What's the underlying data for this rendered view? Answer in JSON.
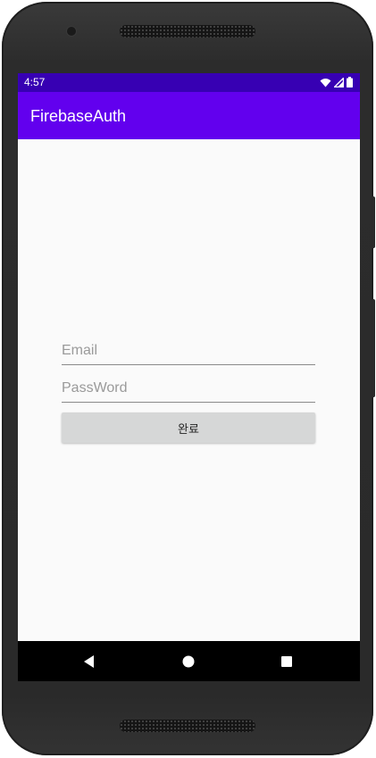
{
  "status_bar": {
    "time": "4:57",
    "color": "#3700b3"
  },
  "app_bar": {
    "title": "FirebaseAuth",
    "color": "#6200ee"
  },
  "form": {
    "email_placeholder": "Email",
    "email_value": "",
    "password_placeholder": "PassWord",
    "password_value": "",
    "submit_label": "완료"
  },
  "nav_bar": {
    "back_icon": "back-triangle-icon",
    "home_icon": "home-circle-icon",
    "recents_icon": "recents-square-icon"
  }
}
